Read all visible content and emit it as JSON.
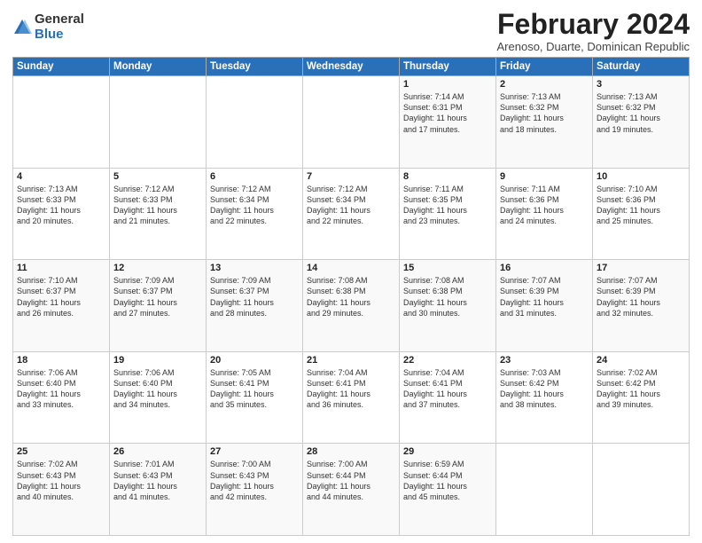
{
  "logo": {
    "general": "General",
    "blue": "Blue"
  },
  "title": "February 2024",
  "subtitle": "Arenoso, Duarte, Dominican Republic",
  "headers": [
    "Sunday",
    "Monday",
    "Tuesday",
    "Wednesday",
    "Thursday",
    "Friday",
    "Saturday"
  ],
  "weeks": [
    [
      {
        "day": "",
        "info": ""
      },
      {
        "day": "",
        "info": ""
      },
      {
        "day": "",
        "info": ""
      },
      {
        "day": "",
        "info": ""
      },
      {
        "day": "1",
        "info": "Sunrise: 7:14 AM\nSunset: 6:31 PM\nDaylight: 11 hours\nand 17 minutes."
      },
      {
        "day": "2",
        "info": "Sunrise: 7:13 AM\nSunset: 6:32 PM\nDaylight: 11 hours\nand 18 minutes."
      },
      {
        "day": "3",
        "info": "Sunrise: 7:13 AM\nSunset: 6:32 PM\nDaylight: 11 hours\nand 19 minutes."
      }
    ],
    [
      {
        "day": "4",
        "info": "Sunrise: 7:13 AM\nSunset: 6:33 PM\nDaylight: 11 hours\nand 20 minutes."
      },
      {
        "day": "5",
        "info": "Sunrise: 7:12 AM\nSunset: 6:33 PM\nDaylight: 11 hours\nand 21 minutes."
      },
      {
        "day": "6",
        "info": "Sunrise: 7:12 AM\nSunset: 6:34 PM\nDaylight: 11 hours\nand 22 minutes."
      },
      {
        "day": "7",
        "info": "Sunrise: 7:12 AM\nSunset: 6:34 PM\nDaylight: 11 hours\nand 22 minutes."
      },
      {
        "day": "8",
        "info": "Sunrise: 7:11 AM\nSunset: 6:35 PM\nDaylight: 11 hours\nand 23 minutes."
      },
      {
        "day": "9",
        "info": "Sunrise: 7:11 AM\nSunset: 6:36 PM\nDaylight: 11 hours\nand 24 minutes."
      },
      {
        "day": "10",
        "info": "Sunrise: 7:10 AM\nSunset: 6:36 PM\nDaylight: 11 hours\nand 25 minutes."
      }
    ],
    [
      {
        "day": "11",
        "info": "Sunrise: 7:10 AM\nSunset: 6:37 PM\nDaylight: 11 hours\nand 26 minutes."
      },
      {
        "day": "12",
        "info": "Sunrise: 7:09 AM\nSunset: 6:37 PM\nDaylight: 11 hours\nand 27 minutes."
      },
      {
        "day": "13",
        "info": "Sunrise: 7:09 AM\nSunset: 6:37 PM\nDaylight: 11 hours\nand 28 minutes."
      },
      {
        "day": "14",
        "info": "Sunrise: 7:08 AM\nSunset: 6:38 PM\nDaylight: 11 hours\nand 29 minutes."
      },
      {
        "day": "15",
        "info": "Sunrise: 7:08 AM\nSunset: 6:38 PM\nDaylight: 11 hours\nand 30 minutes."
      },
      {
        "day": "16",
        "info": "Sunrise: 7:07 AM\nSunset: 6:39 PM\nDaylight: 11 hours\nand 31 minutes."
      },
      {
        "day": "17",
        "info": "Sunrise: 7:07 AM\nSunset: 6:39 PM\nDaylight: 11 hours\nand 32 minutes."
      }
    ],
    [
      {
        "day": "18",
        "info": "Sunrise: 7:06 AM\nSunset: 6:40 PM\nDaylight: 11 hours\nand 33 minutes."
      },
      {
        "day": "19",
        "info": "Sunrise: 7:06 AM\nSunset: 6:40 PM\nDaylight: 11 hours\nand 34 minutes."
      },
      {
        "day": "20",
        "info": "Sunrise: 7:05 AM\nSunset: 6:41 PM\nDaylight: 11 hours\nand 35 minutes."
      },
      {
        "day": "21",
        "info": "Sunrise: 7:04 AM\nSunset: 6:41 PM\nDaylight: 11 hours\nand 36 minutes."
      },
      {
        "day": "22",
        "info": "Sunrise: 7:04 AM\nSunset: 6:41 PM\nDaylight: 11 hours\nand 37 minutes."
      },
      {
        "day": "23",
        "info": "Sunrise: 7:03 AM\nSunset: 6:42 PM\nDaylight: 11 hours\nand 38 minutes."
      },
      {
        "day": "24",
        "info": "Sunrise: 7:02 AM\nSunset: 6:42 PM\nDaylight: 11 hours\nand 39 minutes."
      }
    ],
    [
      {
        "day": "25",
        "info": "Sunrise: 7:02 AM\nSunset: 6:43 PM\nDaylight: 11 hours\nand 40 minutes."
      },
      {
        "day": "26",
        "info": "Sunrise: 7:01 AM\nSunset: 6:43 PM\nDaylight: 11 hours\nand 41 minutes."
      },
      {
        "day": "27",
        "info": "Sunrise: 7:00 AM\nSunset: 6:43 PM\nDaylight: 11 hours\nand 42 minutes."
      },
      {
        "day": "28",
        "info": "Sunrise: 7:00 AM\nSunset: 6:44 PM\nDaylight: 11 hours\nand 44 minutes."
      },
      {
        "day": "29",
        "info": "Sunrise: 6:59 AM\nSunset: 6:44 PM\nDaylight: 11 hours\nand 45 minutes."
      },
      {
        "day": "",
        "info": ""
      },
      {
        "day": "",
        "info": ""
      }
    ]
  ]
}
